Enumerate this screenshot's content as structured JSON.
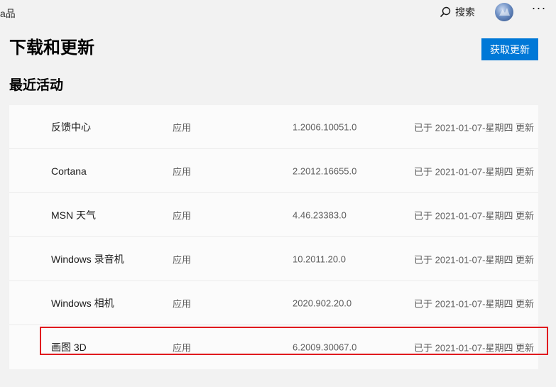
{
  "topbar": {
    "tab_partial": "a品",
    "search_label": "搜索",
    "more_label": "···"
  },
  "page": {
    "title": "下载和更新",
    "update_button": "获取更新",
    "section_title": "最近活动"
  },
  "activity": [
    {
      "name": "反馈中心",
      "type": "应用",
      "version": "1.2006.10051.0",
      "status": "已于 2021-01-07-星期四 更新"
    },
    {
      "name": "Cortana",
      "type": "应用",
      "version": "2.2012.16655.0",
      "status": "已于 2021-01-07-星期四 更新"
    },
    {
      "name": "MSN 天气",
      "type": "应用",
      "version": "4.46.23383.0",
      "status": "已于 2021-01-07-星期四 更新"
    },
    {
      "name": "Windows 录音机",
      "type": "应用",
      "version": "10.2011.20.0",
      "status": "已于 2021-01-07-星期四 更新"
    },
    {
      "name": "Windows 相机",
      "type": "应用",
      "version": "2020.902.20.0",
      "status": "已于 2021-01-07-星期四 更新"
    },
    {
      "name": "画图 3D",
      "type": "应用",
      "version": "6.2009.30067.0",
      "status": "已于 2021-01-07-星期四 更新"
    }
  ],
  "colors": {
    "accent": "#0078d7",
    "highlight": "#e0191e"
  },
  "icons": [
    "search-icon",
    "avatar",
    "more-icon"
  ]
}
